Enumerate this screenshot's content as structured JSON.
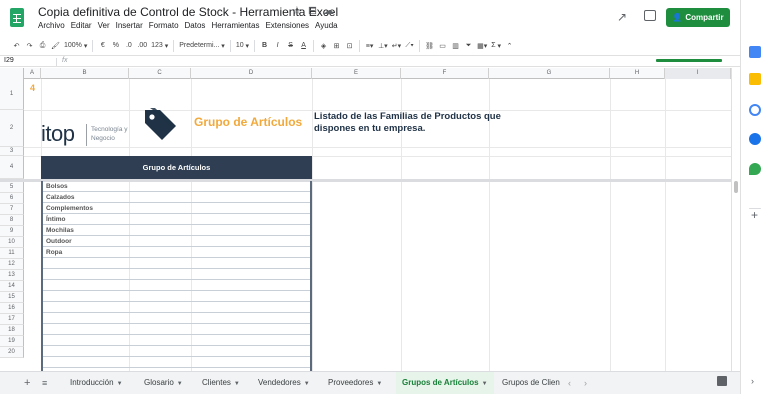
{
  "title_bar": {
    "doc_title": "Copia definitiva de Control de Stock - Herramienta Excel",
    "star_icon": "star-icon",
    "move_icon": "folder-move-icon",
    "cloud_icon": "cloud-status-icon"
  },
  "menu": [
    "Archivo",
    "Editar",
    "Ver",
    "Insertar",
    "Formato",
    "Datos",
    "Herramientas",
    "Extensiones",
    "Ayuda"
  ],
  "share_label": "Compartir",
  "toolbar": {
    "zoom": "100%",
    "currency": "€",
    "percent": "%",
    "decimal_decrease": ".0",
    "decimal_increase": ".00",
    "number_format": "123",
    "font": "Predetermi...",
    "font_size": "10",
    "bold": "B",
    "italic": "I",
    "strike": "S",
    "text_color": "A",
    "sum": "Σ"
  },
  "formula_bar": {
    "cell_ref": "I29",
    "fx": "fx"
  },
  "columns": [
    "A",
    "B",
    "C",
    "D",
    "E",
    "F",
    "G",
    "H",
    "I"
  ],
  "rows": [
    "1",
    "2",
    "3",
    "4",
    "5",
    "6",
    "7",
    "8",
    "9",
    "10",
    "11",
    "12",
    "13",
    "14",
    "15",
    "16",
    "17",
    "18",
    "19",
    "20"
  ],
  "sheet": {
    "cell_a1": "4",
    "brand_name": "itop",
    "brand_tagline": "Tecnología y Negocio",
    "group_title": "Grupo de Artículos",
    "description": "Listado de las Familias de Productos que dispones en tu empresa.",
    "table_header": "Grupo de Artículos",
    "items": [
      "Bolsos",
      "Calzados",
      "Complementos",
      "Íntimo",
      "Mochilas",
      "Outdoor",
      "Ropa",
      "",
      "",
      "",
      "",
      "",
      "",
      "",
      "",
      "",
      ""
    ]
  },
  "tabs": [
    {
      "label": "Introducción",
      "active": false
    },
    {
      "label": "Glosario",
      "active": false
    },
    {
      "label": "Clientes",
      "active": false
    },
    {
      "label": "Vendedores",
      "active": false
    },
    {
      "label": "Proveedores",
      "active": false
    },
    {
      "label": "Grupos de Artículos",
      "active": true
    },
    {
      "label": "Grupos de Clien",
      "active": false
    }
  ],
  "colors": {
    "brand_navy": "#1f3246",
    "accent_orange": "#f2a93b",
    "share_green": "#1e8e3e",
    "header_bg": "#2f3e52"
  }
}
